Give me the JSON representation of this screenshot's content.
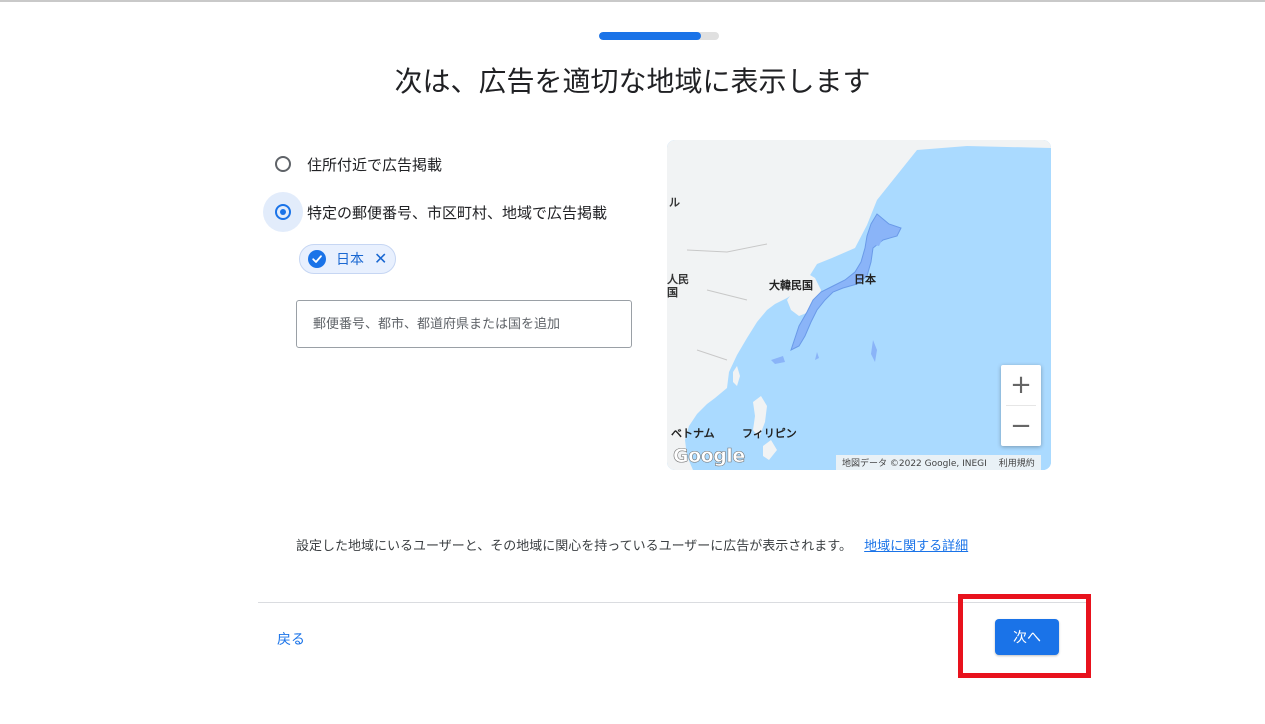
{
  "progress": {
    "fraction": 0.85
  },
  "page_title": "次は、広告を適切な地域に表示します",
  "location_options": [
    {
      "label": "住所付近で広告掲載",
      "selected": false
    },
    {
      "label": "特定の郵便番号、市区町村、地域で広告掲載",
      "selected": true
    }
  ],
  "selected_chip": {
    "label": "日本",
    "remove_glyph": "✕"
  },
  "search": {
    "placeholder": "郵便番号、都市、都道府県または国を追加",
    "value": ""
  },
  "map": {
    "labels": {
      "mongolia_partial": "ル",
      "china_partial_1": "人民",
      "china_partial_2": "国",
      "korea": "大韓民国",
      "japan": "日本",
      "vietnam": "ベトナム",
      "philippines": "フィリピン"
    },
    "logo": "Google",
    "attribution": "地図データ ©2022 Google, INEGI",
    "terms": "利用規約",
    "zoom_in": "+",
    "zoom_out": "−",
    "colors": {
      "water": "#aadaff",
      "land": "#f1f3f4",
      "highlight": "#8ab4f8"
    }
  },
  "info": {
    "text": "設定した地域にいるユーザーと、その地域に関心を持っているユーザーに広告が表示されます。",
    "link": "地域に関する詳細"
  },
  "footer": {
    "back_label": "戻る",
    "next_label": "次へ"
  },
  "accent_color": "#1a73e8",
  "highlight_color": "#e8121d"
}
